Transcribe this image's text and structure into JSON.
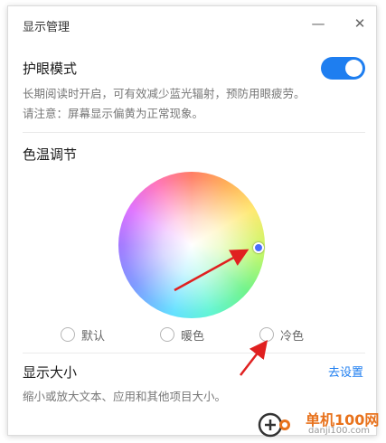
{
  "window": {
    "title": "显示管理",
    "minimize_glyph": "—",
    "close_glyph": "✕"
  },
  "eye_protection": {
    "title": "护眼模式",
    "enabled": true,
    "desc_line1": "长期阅读时开启，可有效减少蓝光辐射，预防用眼疲劳。",
    "desc_line2": "请注意：屏幕显示偏黄为正常现象。"
  },
  "color_temp": {
    "title": "色温调节",
    "options": [
      {
        "label": "默认",
        "selected": false
      },
      {
        "label": "暖色",
        "selected": false
      },
      {
        "label": "冷色",
        "selected": false
      }
    ]
  },
  "display_size": {
    "title": "显示大小",
    "link": "去设置",
    "desc": "缩小或放大文本、应用和其他项目大小。"
  },
  "watermark": {
    "name": "单机100网",
    "url": "danji100.com"
  },
  "colors": {
    "accent": "#1e7ef0",
    "arrow": "#e02020",
    "watermark": "#e8721c"
  }
}
